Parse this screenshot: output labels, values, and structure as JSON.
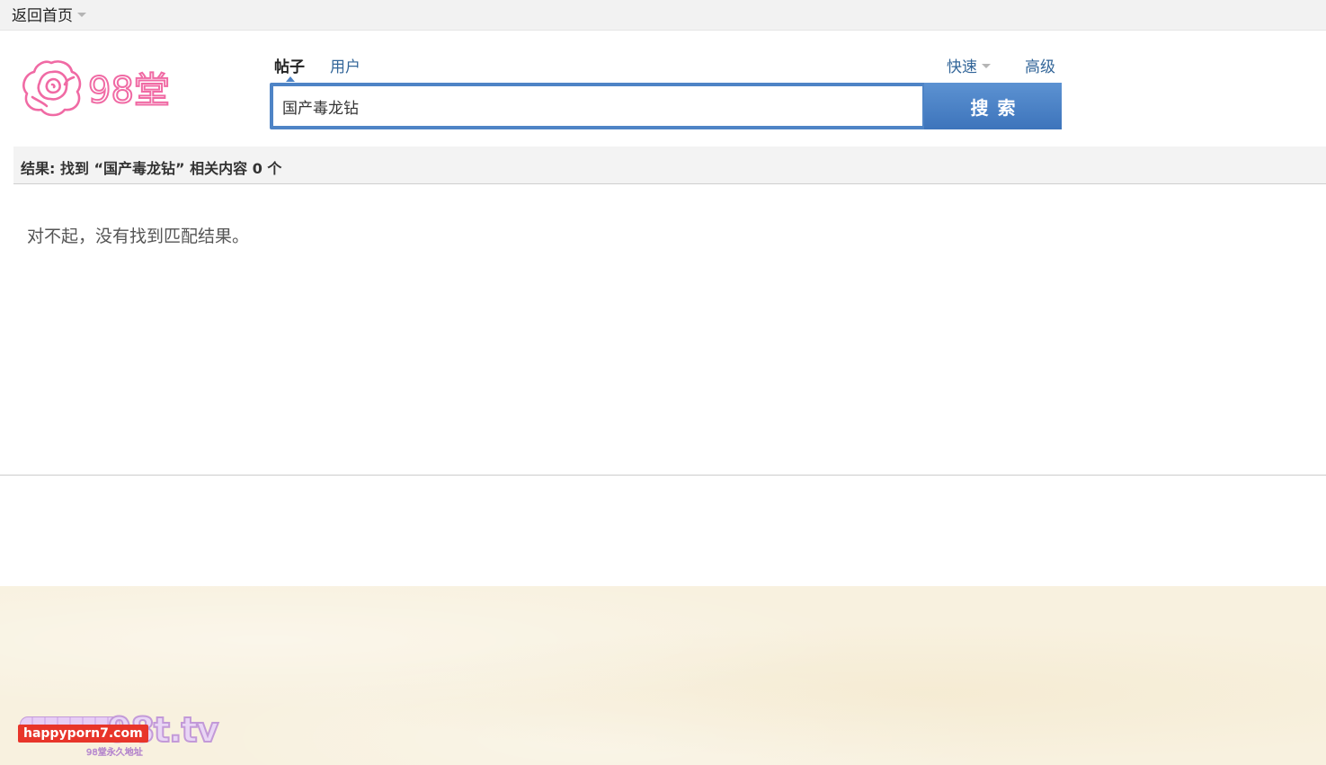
{
  "topbar": {
    "home_label": "返回首页"
  },
  "logo": {
    "text": "98堂",
    "color": "#f06aa4"
  },
  "search": {
    "tabs": [
      {
        "label": "帖子",
        "active": true
      },
      {
        "label": "用户",
        "active": false
      }
    ],
    "quick_label": "快速",
    "advanced_label": "高级",
    "input_value": "国产毒龙钻",
    "button_label": "搜索"
  },
  "results": {
    "summary": "结果: 找到 “国产毒龙钻” 相关内容 0 个",
    "empty_message": "对不起，没有找到匹配结果。"
  },
  "watermark": {
    "site_tag": "happyporn7.com",
    "domain_text": "98t.tv",
    "sub_text": "98堂永久地址"
  },
  "colors": {
    "accent": "#4e84c6",
    "link": "#336699",
    "footer_bg": "#f8f1df",
    "tag_red": "#e8352a"
  }
}
